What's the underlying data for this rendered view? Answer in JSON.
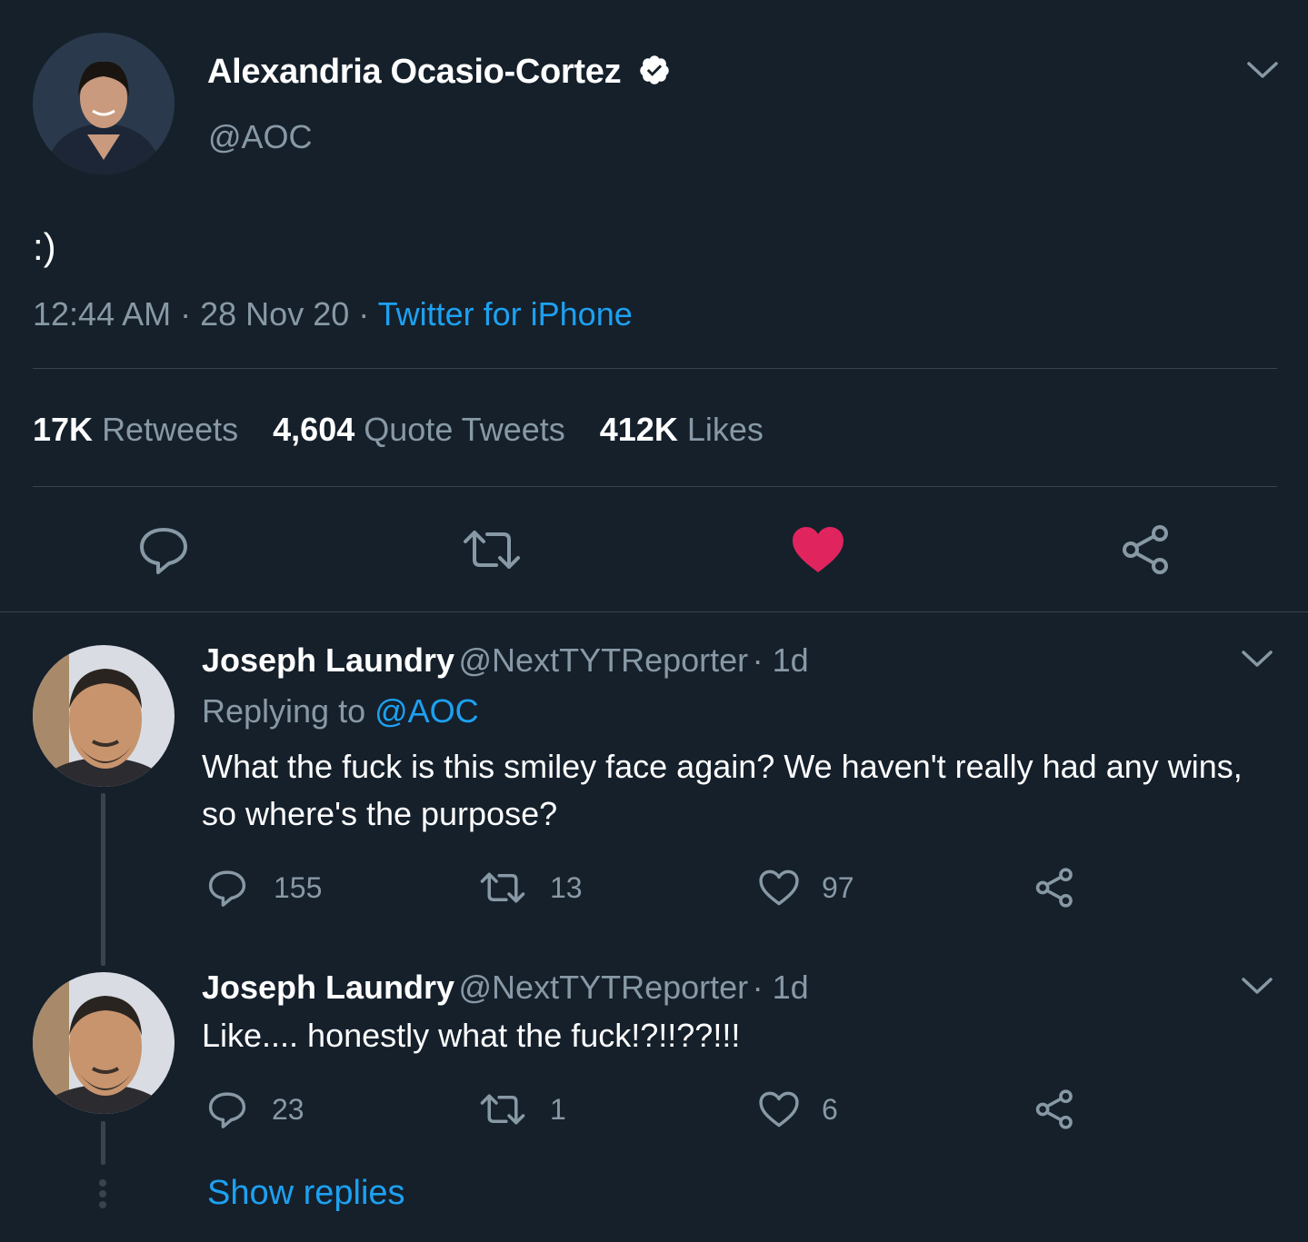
{
  "main_tweet": {
    "author_name": "Alexandria Ocasio-Cortez",
    "handle": "@AOC",
    "text": ":)",
    "time": "12:44 AM",
    "date": "28 Nov 20",
    "separator": "·",
    "source": "Twitter for iPhone",
    "stats": {
      "retweets_count": "17K",
      "retweets_label": "Retweets",
      "quotes_count": "4,604",
      "quotes_label": "Quote Tweets",
      "likes_count": "412K",
      "likes_label": "Likes"
    },
    "liked": true
  },
  "replies": [
    {
      "author_name": "Joseph Laundry",
      "handle": "@NextTYTReporter",
      "age": "· 1d",
      "replying_prefix": "Replying to",
      "replying_to": "@AOC",
      "text": "What the fuck is this smiley face again? We haven't really had any wins, so where's the purpose?",
      "reply_count": "155",
      "retweet_count": "13",
      "like_count": "97"
    },
    {
      "author_name": "Joseph Laundry",
      "handle": "@NextTYTReporter",
      "age": "· 1d",
      "text": "Like.... honestly what the fuck!?!!??!!!",
      "reply_count": "23",
      "retweet_count": "1",
      "like_count": "6"
    }
  ],
  "show_replies_label": "Show replies",
  "colors": {
    "background": "#15202b",
    "accent": "#1da1f2",
    "like": "#e0245e",
    "muted": "#8899a6",
    "divider": "#38444d"
  }
}
